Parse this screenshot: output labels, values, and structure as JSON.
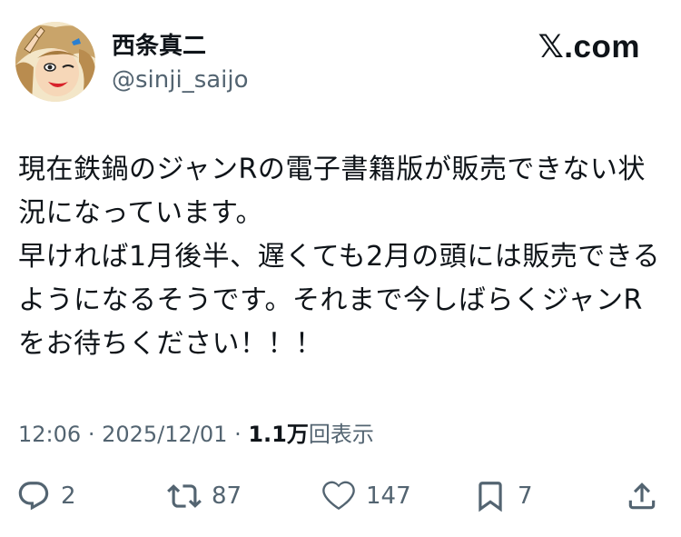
{
  "author": {
    "display_name": "西条真二",
    "handle": "@sinji_saijo"
  },
  "brand": {
    "label": "𝕏.com"
  },
  "tweet": {
    "text": "現在鉄鍋のジャンRの電子書籍版が販売できない状況になっています。\n早ければ1月後半、遅くても2月の頭には販売できるようになるそうです。それまで今しばらくジャンRをお待ちください！！！"
  },
  "meta": {
    "time": "12:06",
    "separator": "·",
    "date": "2025/12/01",
    "views_count": "1.1万",
    "views_label": "回表示"
  },
  "actions": {
    "replies": "2",
    "retweets": "87",
    "likes": "147",
    "bookmarks": "7"
  },
  "colors": {
    "text": "#0f1419",
    "secondary": "#536471",
    "background": "#ffffff"
  },
  "icons": [
    "reply-icon",
    "retweet-icon",
    "like-icon",
    "bookmark-icon",
    "share-icon"
  ]
}
